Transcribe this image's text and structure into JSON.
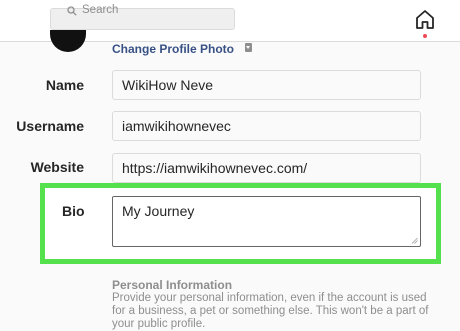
{
  "search": {
    "placeholder": "Search"
  },
  "profile": {
    "change_photo_label": "Change Profile Photo"
  },
  "form": {
    "name": {
      "label": "Name",
      "value": "WikiHow Neve"
    },
    "username": {
      "label": "Username",
      "value": "iamwikihownevec"
    },
    "website": {
      "label": "Website",
      "value": "https://iamwikihownevec.com/"
    },
    "bio": {
      "label": "Bio",
      "value": "My Journey"
    }
  },
  "personal_info": {
    "title": "Personal Information",
    "description": "Provide your personal information, even if the account is used for a business, a pet or something else. This won't be a part of your public profile."
  },
  "colors": {
    "highlight": "#55e04d",
    "link": "#385185",
    "notification_dot": "#ed4956"
  },
  "icons": [
    "search-icon",
    "home-icon",
    "photo-caret-icon",
    "resize-grip-icon"
  ]
}
